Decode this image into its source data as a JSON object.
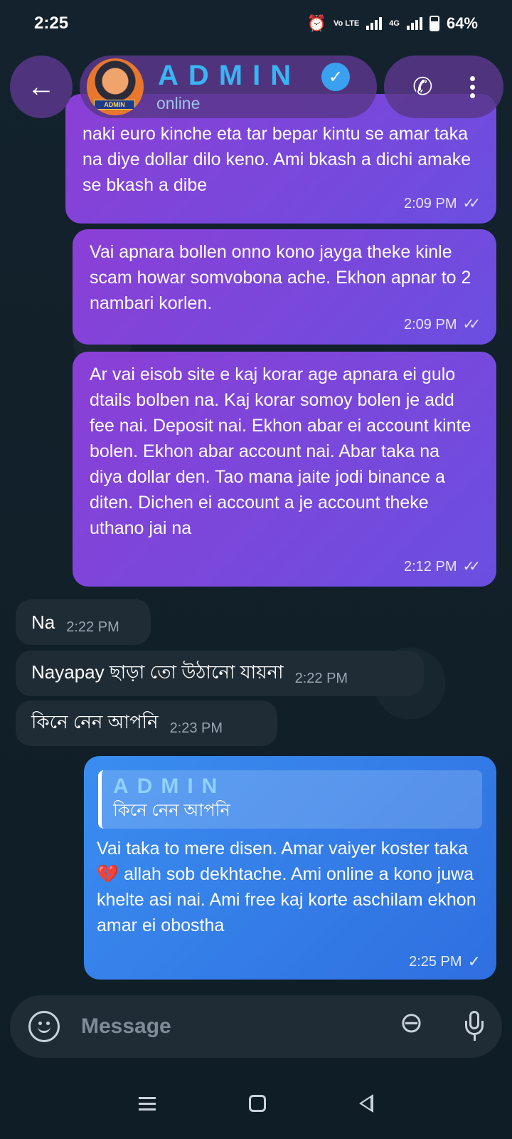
{
  "status_bar": {
    "time": "2:25",
    "battery": "64%",
    "net_volte": "Vo LTE",
    "net_type": "4G",
    "battery_level": 0.64
  },
  "header": {
    "back_icon": "arrow-left-icon",
    "contact_name": "ADMIN",
    "avatar_badge": "ADMIN",
    "status": "online",
    "call_icon": "phone-icon",
    "menu_icon": "more-vert-icon"
  },
  "messages": [
    {
      "type": "outgoing",
      "text": "naki euro kinche eta tar bepar   kintu se amar taka na diye dollar dilo keno. Ami bkash a dichi amake se bkash a dibe",
      "time": "2:09 PM",
      "status": "read"
    },
    {
      "type": "outgoing",
      "text": "Vai apnara bollen onno kono jayga theke kinle scam howar somvobona ache. Ekhon apnar to 2 nambari korlen.",
      "time": "2:09 PM",
      "status": "read"
    },
    {
      "type": "outgoing",
      "text": "Ar vai eisob site e kaj korar age apnara ei gulo dtails bolben na. Kaj korar somoy bolen je add fee nai. Deposit nai. Ekhon abar ei account kinte bolen. Ekhon abar account nai. Abar taka na diya dollar den. Tao mana jaite jodi binance a diten. Dichen ei account a je account theke uthano jai na",
      "time": "2:12 PM",
      "status": "read"
    },
    {
      "type": "incoming",
      "text": "Na",
      "time": "2:22 PM"
    },
    {
      "type": "incoming",
      "text": "Nayapay ছাড়া তো উঠানো যায়না",
      "time": "2:22 PM"
    },
    {
      "type": "incoming",
      "text": "কিনে নেন আপনি",
      "time": "2:23 PM"
    },
    {
      "type": "outgoing_reply",
      "reply_to": {
        "name": "ADMIN",
        "text": "কিনে নেন আপনি"
      },
      "text_before": "Vai taka to mere disen. Amar vaiyer koster taka ",
      "emoji": "💔",
      "text_after": " allah sob dekhtache. Ami online a kono juwa khelte asi nai. Ami free kaj korte aschilam ekhon amar ei obostha",
      "time": "2:25 PM",
      "status": "sent"
    }
  ],
  "composer": {
    "placeholder": "Message",
    "emoji_icon": "emoji-icon",
    "attach_icon": "paperclip-icon",
    "mic_icon": "mic-icon"
  },
  "nav": {
    "recent_icon": "menu-icon",
    "home_icon": "home-icon",
    "back_icon": "back-triangle-icon"
  },
  "colors": {
    "bubble_purple": "#8b3fd6",
    "bubble_blue": "#3a8df0",
    "incoming": "#1f2c36",
    "accent_name": "#3ab4f2"
  }
}
